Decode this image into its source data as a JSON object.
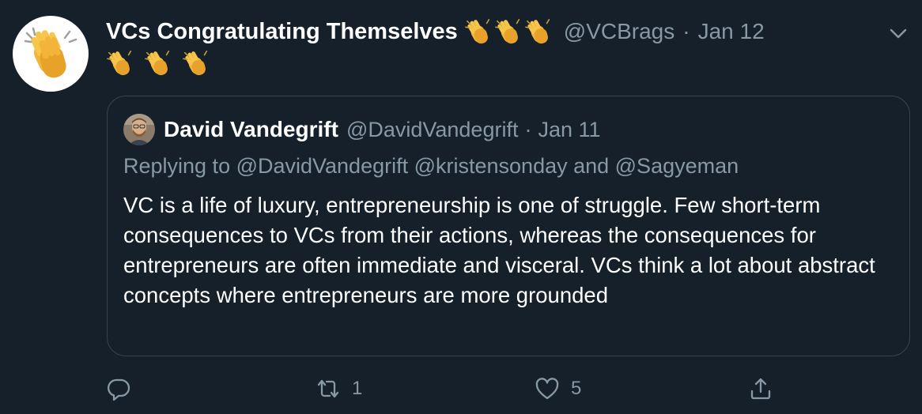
{
  "tweet": {
    "display_name": "VCs Congratulating Themselves",
    "handle": "@VCBrags",
    "separator": "·",
    "date": "Jan 12",
    "avatar_icon": "clapping-hands-icon",
    "name_emojis": [
      "clapping-hands-icon",
      "clapping-hands-icon",
      "clapping-hands-icon"
    ],
    "body_emojis": [
      "clapping-hands-icon",
      "clapping-hands-icon",
      "clapping-hands-icon"
    ],
    "menu_icon": "chevron-down-icon"
  },
  "quoted": {
    "display_name": "David Vandegrift",
    "handle": "@DavidVandegrift",
    "separator": "·",
    "date": "Jan 11",
    "replying_to": "Replying to @DavidVandegrift @kristensonday and @Sagyeman",
    "text": "VC is a life of luxury, entrepreneurship is one of struggle. Few short-term consequences to VCs from their actions, whereas the consequences for entrepreneurs are often immediate and visceral. VCs think a lot about abstract concepts where entrepreneurs are more grounded"
  },
  "actions": {
    "reply_count": "",
    "retweet_count": "1",
    "like_count": "5",
    "share_count": ""
  },
  "colors": {
    "background": "#15202b",
    "secondary_text": "#8899a6",
    "border": "#38444d",
    "clap_yellow": "#fbc02d"
  }
}
